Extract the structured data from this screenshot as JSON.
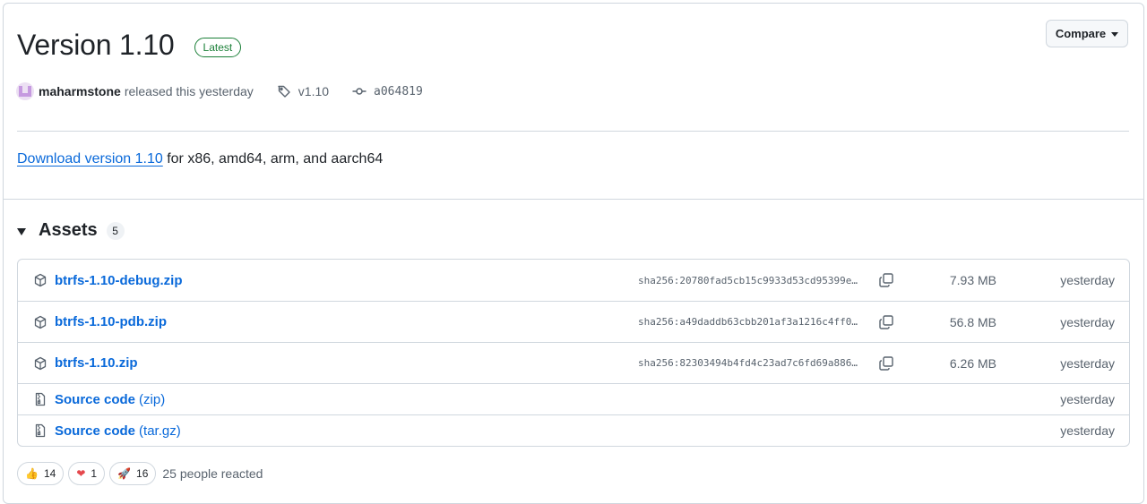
{
  "release": {
    "title": "Version 1.10",
    "latest_badge": "Latest",
    "compare_label": "Compare",
    "author": "maharmstone",
    "released_text": "released this yesterday",
    "tag": "v1.10",
    "commit": "a064819"
  },
  "download": {
    "link_text": "Download version 1.10",
    "rest_text": " for x86, amd64, arm, and aarch64"
  },
  "assets": {
    "title": "Assets",
    "count": "5",
    "items": [
      {
        "name": "btrfs-1.10-debug.zip",
        "sha": "sha256:20780fad5cb15c9933d53cd95399e…",
        "size": "7.93 MB",
        "date": "yesterday",
        "icon": "package-icon"
      },
      {
        "name": "btrfs-1.10-pdb.zip",
        "sha": "sha256:a49daddb63cbb201af3a1216c4ff0…",
        "size": "56.8 MB",
        "date": "yesterday",
        "icon": "package-icon"
      },
      {
        "name": "btrfs-1.10.zip",
        "sha": "sha256:82303494b4fd4c23ad7c6fd69a886…",
        "size": "6.26 MB",
        "date": "yesterday",
        "icon": "package-icon"
      },
      {
        "name": "Source code",
        "suffix": "(zip)",
        "date": "yesterday",
        "icon": "file-zip-icon"
      },
      {
        "name": "Source code",
        "suffix": "(tar.gz)",
        "date": "yesterday",
        "icon": "file-zip-icon"
      }
    ]
  },
  "reactions": {
    "items": [
      {
        "emoji": "👍",
        "count": "14",
        "icon": "thumbs-up-icon"
      },
      {
        "emoji": "❤",
        "count": "1",
        "icon": "heart-icon"
      },
      {
        "emoji": "🚀",
        "count": "16",
        "icon": "rocket-icon"
      }
    ],
    "summary": "25 people reacted"
  },
  "colors": {
    "link": "#0969da",
    "latest": "#1a7f37",
    "border": "#d0d7de",
    "muted": "#59636e"
  }
}
